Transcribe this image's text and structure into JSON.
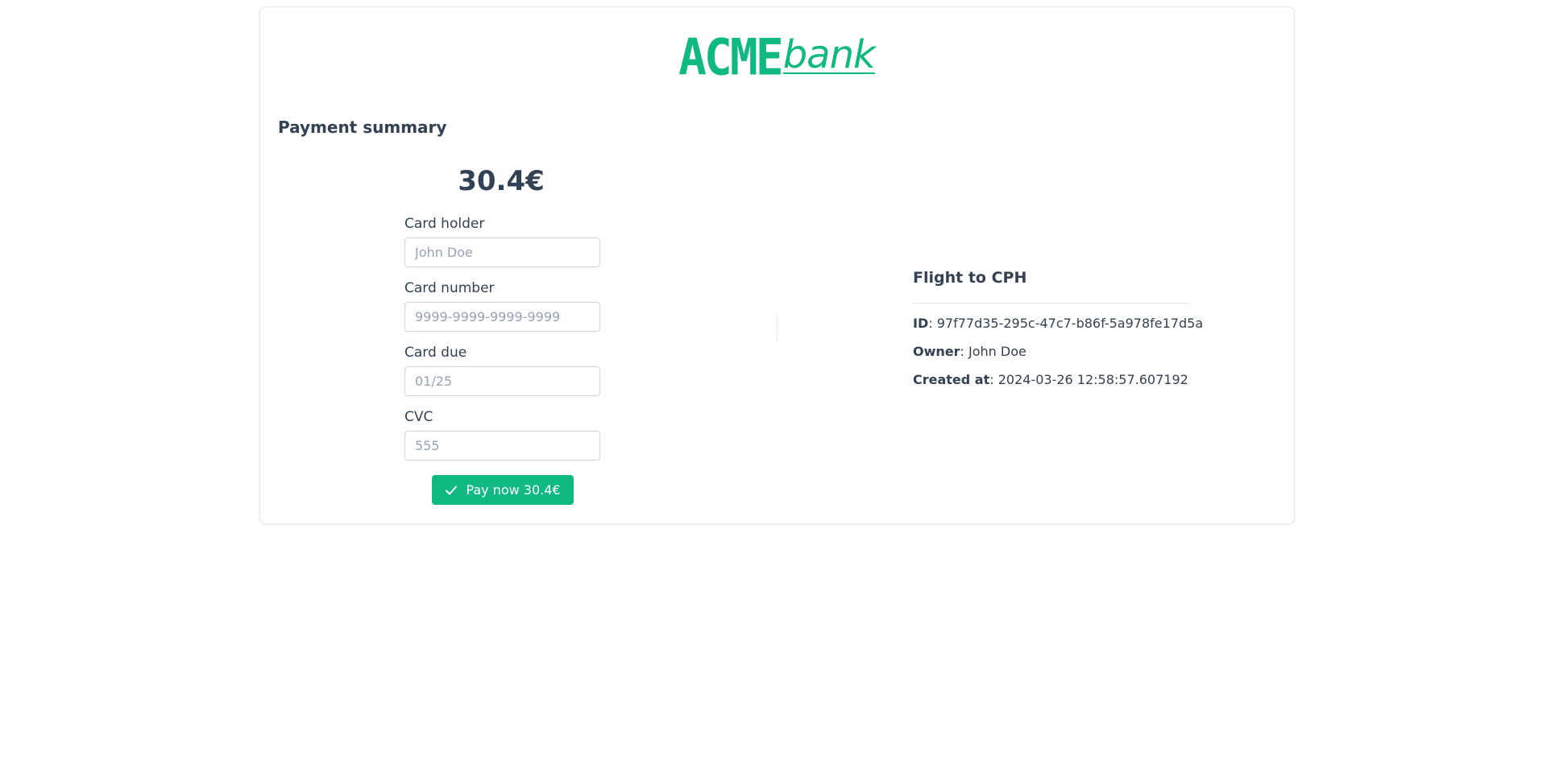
{
  "brand": {
    "logo_primary": "ACME",
    "logo_secondary": "bank",
    "color": "#10b981"
  },
  "payment": {
    "section_title": "Payment summary",
    "amount": "30.4€",
    "fields": [
      {
        "label": "Card holder",
        "placeholder": "John Doe",
        "value": ""
      },
      {
        "label": "Card number",
        "placeholder": "9999-9999-9999-9999",
        "value": ""
      },
      {
        "label": "Card due",
        "placeholder": "01/25",
        "value": ""
      },
      {
        "label": "CVC",
        "placeholder": "555",
        "value": ""
      }
    ],
    "pay_button_label": "Pay now 30.4€",
    "pay_button_icon": "check-icon"
  },
  "details": {
    "title": "Flight to CPH",
    "rows": [
      {
        "key": "ID",
        "value": "97f77d35-295c-47c7-b86f-5a978fe17d5a"
      },
      {
        "key": "Owner",
        "value": "John Doe"
      },
      {
        "key": "Created at",
        "value": "2024-03-26 12:58:57.607192"
      }
    ]
  }
}
